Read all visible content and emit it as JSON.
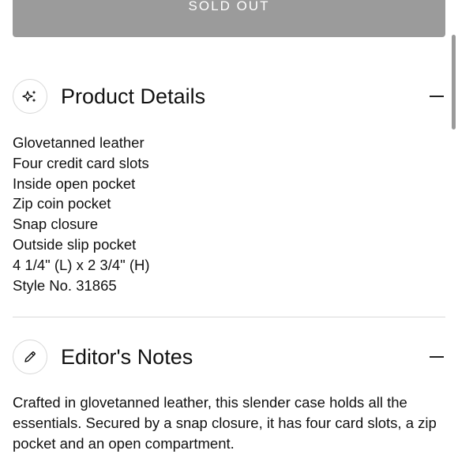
{
  "buy_button": {
    "label": "SOLD OUT"
  },
  "product_details": {
    "title": "Product Details",
    "icon": "sparkles-icon",
    "items": [
      "Glovetanned leather",
      "Four credit card slots",
      "Inside open pocket",
      "Zip coin pocket",
      "Snap closure",
      "Outside slip pocket",
      "4 1/4\" (L) x 2 3/4\" (H)",
      "Style No. 31865"
    ]
  },
  "editors_notes": {
    "title": "Editor's Notes",
    "icon": "pencil-icon",
    "text": "Crafted in glovetanned leather, this slender case holds all the essentials. Secured by a snap closure, it has four card slots, a zip pocket and an open compartment."
  },
  "colors": {
    "sold_out_bg": "#9b9b9b",
    "divider": "#d9d9d9",
    "text": "#111111"
  }
}
